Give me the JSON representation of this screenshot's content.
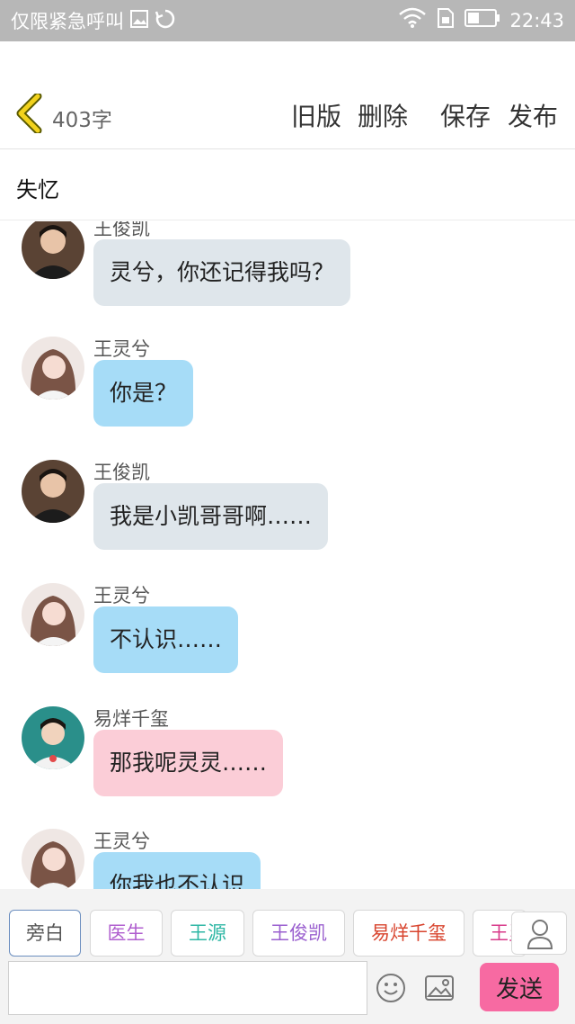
{
  "status_bar": {
    "left_text": "仅限紧急呼叫",
    "time": "22:43"
  },
  "header": {
    "word_count": "403字",
    "buttons": {
      "old_version": "旧版",
      "delete": "删除",
      "save": "保存",
      "publish": "发布"
    }
  },
  "story_title": "失忆",
  "messages": [
    {
      "sender": "王俊凯",
      "text": "灵兮，你还记得我吗？",
      "bubble": "gray"
    },
    {
      "sender": "王灵兮",
      "text": "你是？",
      "bubble": "blue"
    },
    {
      "sender": "王俊凯",
      "text": "我是小凯哥哥啊……",
      "bubble": "gray"
    },
    {
      "sender": "王灵兮",
      "text": "不认识……",
      "bubble": "blue"
    },
    {
      "sender": "易烊千玺",
      "text": "那我呢灵灵……",
      "bubble": "pink"
    },
    {
      "sender": "王灵兮",
      "text": "你我也不认识",
      "bubble": "blue"
    }
  ],
  "roles": [
    {
      "label": "旁白",
      "color": "#555555",
      "active": true
    },
    {
      "label": "医生",
      "color": "#b05fcf"
    },
    {
      "label": "王源",
      "color": "#2fb7a5"
    },
    {
      "label": "王俊凯",
      "color": "#9a5fcf"
    },
    {
      "label": "易烊千玺",
      "color": "#d8442e"
    },
    {
      "label": "王灵兮",
      "color": "#d83a8a"
    }
  ],
  "input": {
    "value": "",
    "placeholder": ""
  },
  "send_button": "发送",
  "colors": {
    "send_button": "#f76aa2",
    "bubble_gray": "#dfe6eb",
    "bubble_blue": "#a6dcf7",
    "bubble_pink": "#fbcdd7",
    "back_arrow": "#f2d21c"
  }
}
